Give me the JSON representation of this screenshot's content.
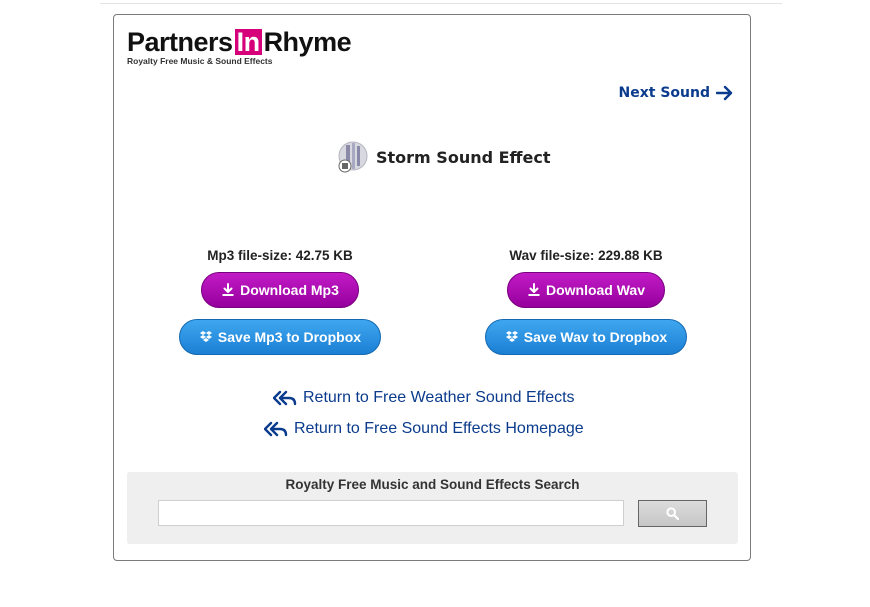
{
  "logo": {
    "part1": "Partners",
    "part2": "In",
    "part3": "Rhyme",
    "tagline": "Royalty Free Music & Sound Effects"
  },
  "nav": {
    "next_label": "Next Sound"
  },
  "sound": {
    "title": "Storm Sound Effect"
  },
  "mp3": {
    "filesize": "Mp3 file-size: 42.75 KB",
    "download_label": "Download Mp3",
    "dropbox_label": "Save Mp3 to Dropbox"
  },
  "wav": {
    "filesize": "Wav file-size: 229.88 KB",
    "download_label": "Download Wav",
    "dropbox_label": "Save Wav to Dropbox"
  },
  "links": {
    "return_category": "Return to Free Weather Sound Effects",
    "return_home": "Return to Free Sound Effects Homepage"
  },
  "search": {
    "title": "Royalty Free Music and Sound Effects Search",
    "placeholder": ""
  },
  "colors": {
    "brand_magenta": "#d6007b",
    "download_button": "#ad10b3",
    "dropbox_button": "#2a8fe0",
    "link_blue": "#0b3b8c"
  }
}
